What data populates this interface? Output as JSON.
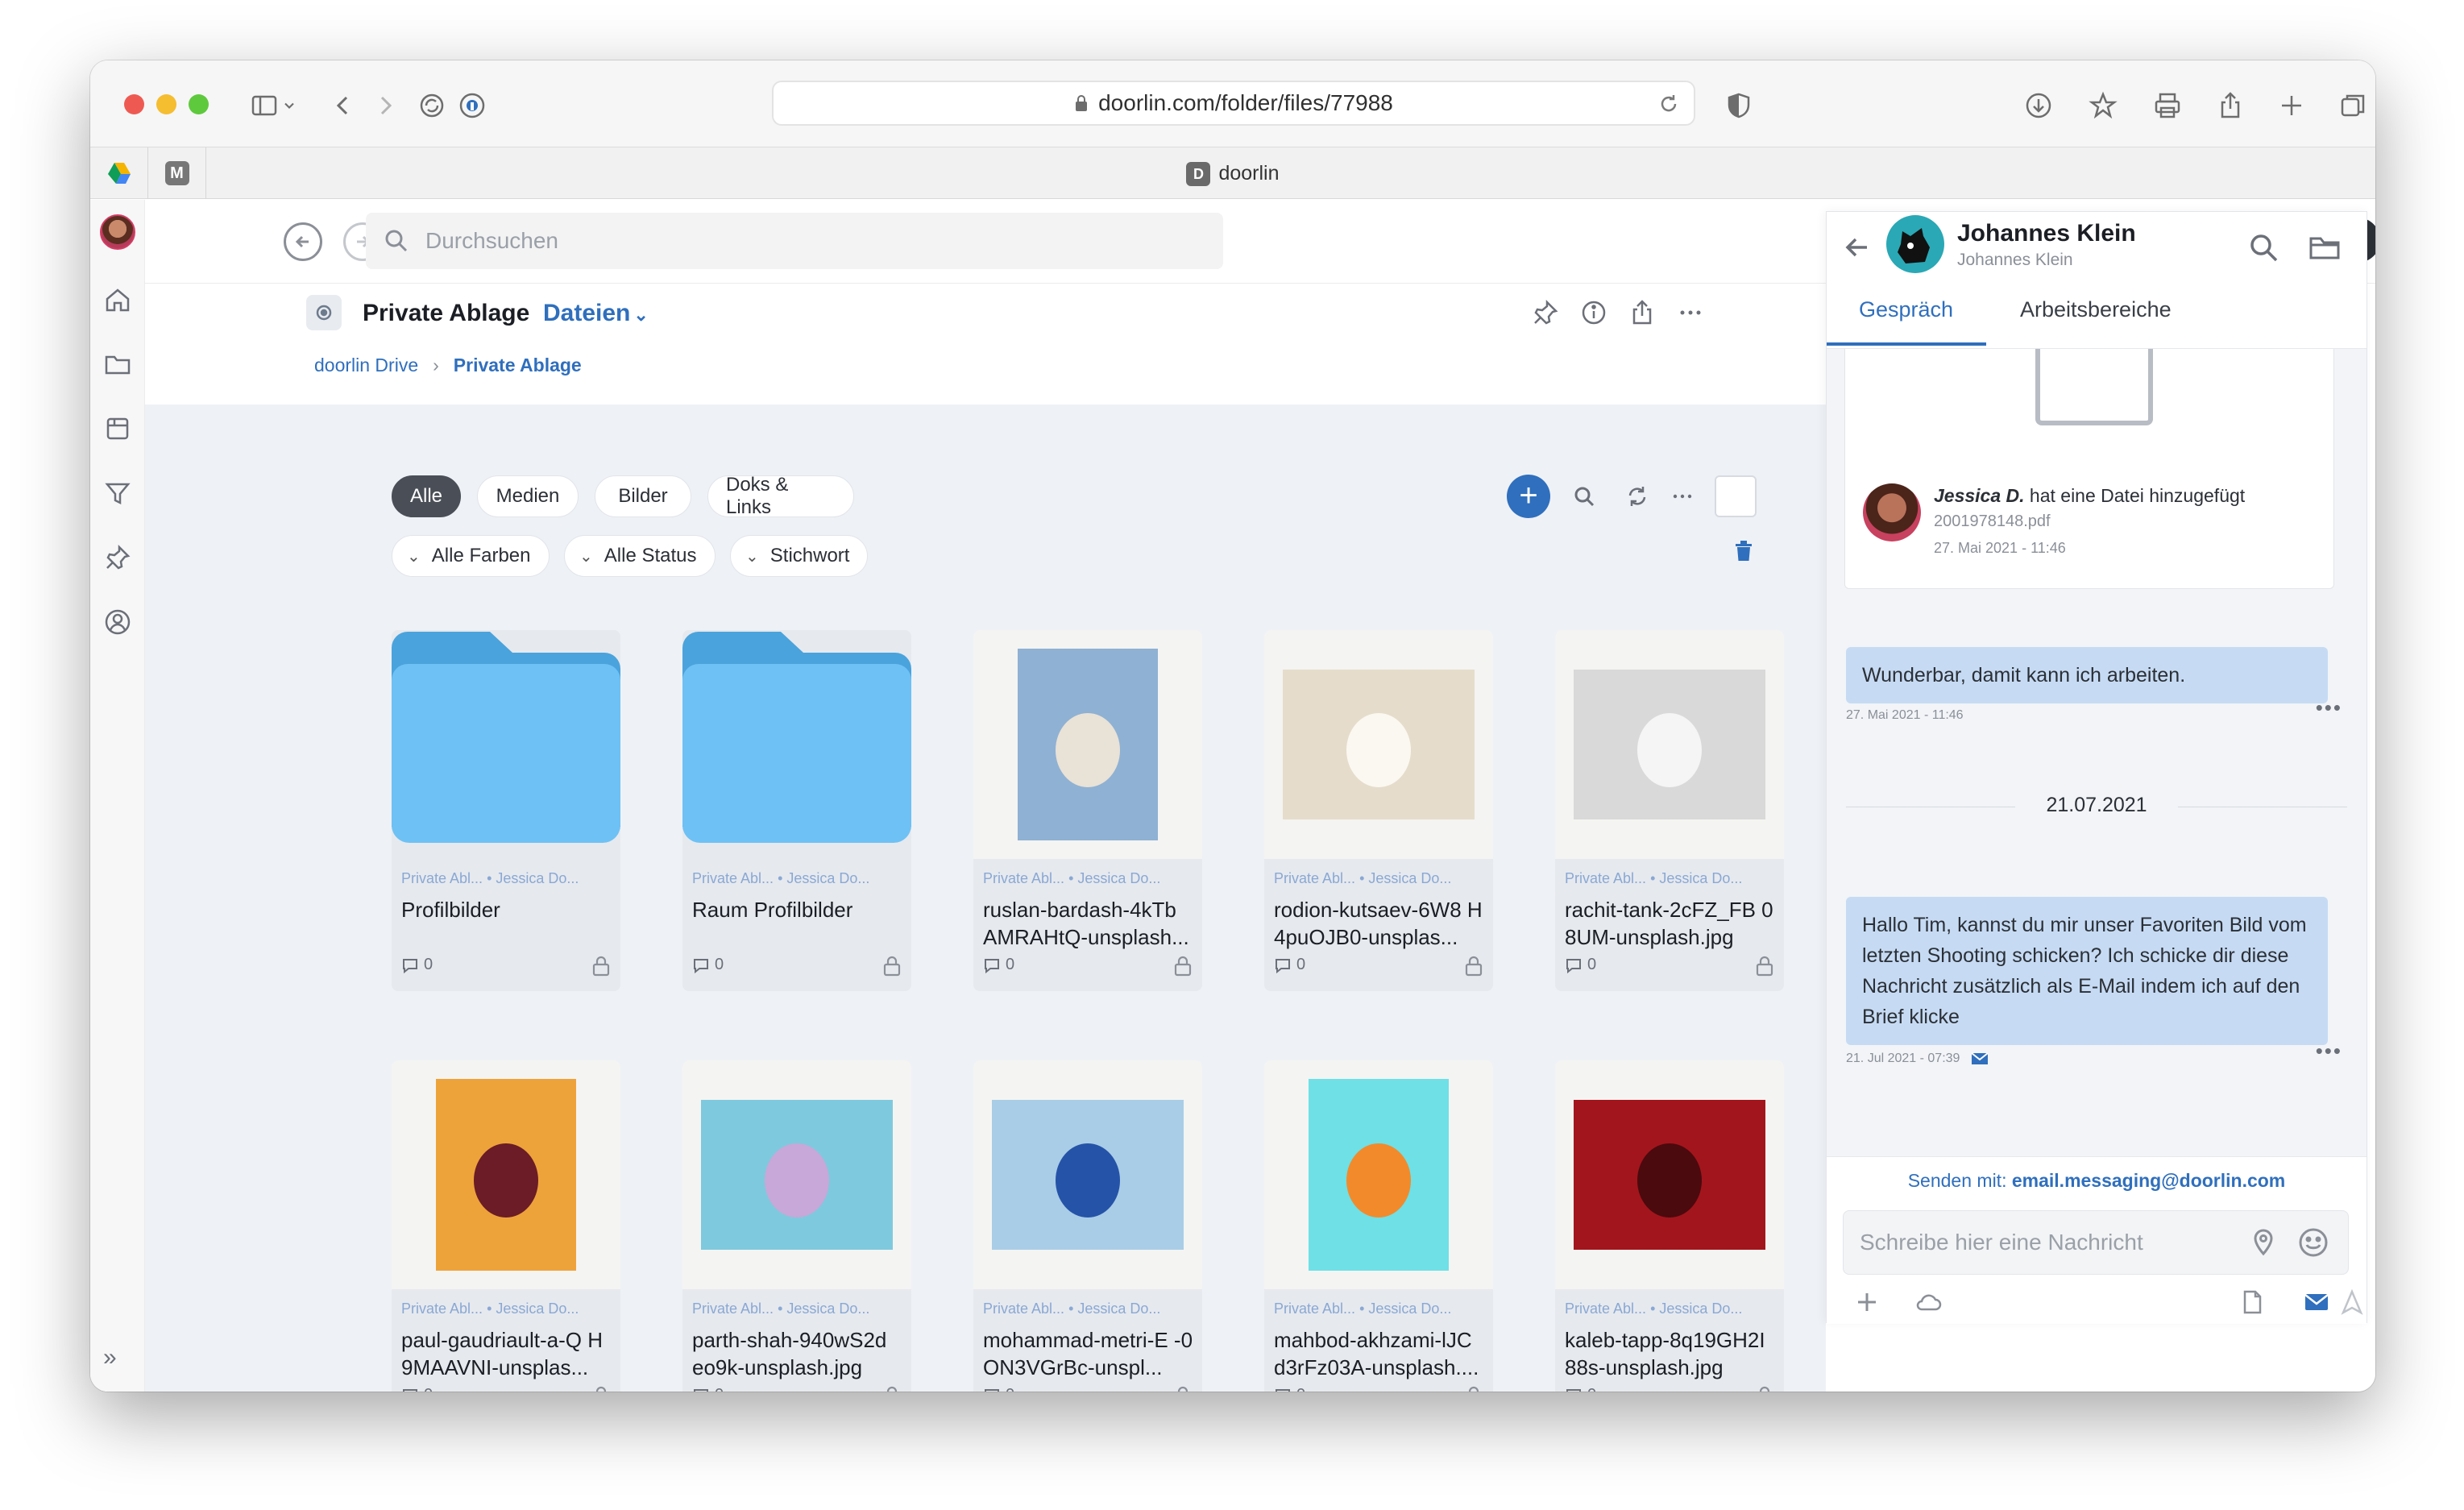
{
  "browser": {
    "url": "doorlin.com/folder/files/77988",
    "tab_title": "doorlin",
    "tab_favicon_letter": "D",
    "pinned_tab_2_letter": "M"
  },
  "search": {
    "placeholder": "Durchsuchen"
  },
  "header": {
    "title": "Private Ablage",
    "view_label": "Dateien",
    "breadcrumb": [
      "doorlin Drive",
      "Private Ablage"
    ]
  },
  "filters": {
    "chips": [
      "Alle",
      "Medien",
      "Bilder",
      "Doks & Links"
    ],
    "active_chip": "Alle",
    "dropdowns": [
      "Alle Farben",
      "Alle Status",
      "Stichwort"
    ]
  },
  "files": [
    {
      "kind": "folder",
      "meta_location": "Private Abl...",
      "meta_owner": "Jessica Do...",
      "name": "Profilbilder",
      "comments": "0"
    },
    {
      "kind": "folder",
      "meta_location": "Private Abl...",
      "meta_owner": "Jessica Do...",
      "name": "Raum Profilbilder",
      "comments": "0"
    },
    {
      "kind": "image",
      "meta_location": "Private Abl...",
      "meta_owner": "Jessica Do...",
      "name": "ruslan-bardash-4kTb AMRAHtQ-unsplash...",
      "comments": "0",
      "thumb_bg": "#8fb1d3",
      "thumb_fg": "#e9e2d6",
      "thumb_ground": "#f4f4f2"
    },
    {
      "kind": "image",
      "meta_location": "Private Abl...",
      "meta_owner": "Jessica Do...",
      "name": "rodion-kutsaev-6W8 H4puOJB0-unsplas...",
      "comments": "0",
      "thumb_bg": "#e5dccb",
      "thumb_fg": "#fbf8f1",
      "thumb_ground": "#f4f4f2"
    },
    {
      "kind": "image",
      "meta_location": "Private Abl...",
      "meta_owner": "Jessica Do...",
      "name": "rachit-tank-2cFZ_FB 08UM-unsplash.jpg",
      "comments": "0",
      "thumb_bg": "#d9d9d9",
      "thumb_fg": "#f5f5f5",
      "thumb_ground": "#f4f4f2"
    },
    {
      "kind": "image",
      "meta_location": "Private Abl...",
      "meta_owner": "Jessica Do...",
      "name": "paul-gaudriault-a-Q H9MAAVNI-unsplas...",
      "comments": "0",
      "thumb_bg": "#eea33a",
      "thumb_fg": "#6b1c26",
      "thumb_ground": "#f4f4f2"
    },
    {
      "kind": "image",
      "meta_location": "Private Abl...",
      "meta_owner": "Jessica Do...",
      "name": "parth-shah-940wS2d eo9k-unsplash.jpg",
      "comments": "0",
      "thumb_bg": "#7fc9de",
      "thumb_fg": "#c7a8d8",
      "thumb_ground": "#f4f4f2"
    },
    {
      "kind": "image",
      "meta_location": "Private Abl...",
      "meta_owner": "Jessica Do...",
      "name": "mohammad-metri-E -0ON3VGrBc-unspl...",
      "comments": "0",
      "thumb_bg": "#a9cde6",
      "thumb_fg": "#2553a8",
      "thumb_ground": "#f4f4f2"
    },
    {
      "kind": "image",
      "meta_location": "Private Abl...",
      "meta_owner": "Jessica Do...",
      "name": "mahbod-akhzami-lJC d3rFz03A-unsplash....",
      "comments": "0",
      "thumb_bg": "#6ee0e6",
      "thumb_fg": "#f28a2c",
      "thumb_ground": "#f4f4f2"
    },
    {
      "kind": "image",
      "meta_location": "Private Abl...",
      "meta_owner": "Jessica Do...",
      "name": "kaleb-tapp-8q19GH2I 88s-unsplash.jpg",
      "comments": "0",
      "thumb_bg": "#a3151c",
      "thumb_fg": "#4a0a0e",
      "thumb_ground": "#f4f4f2"
    }
  ],
  "chat": {
    "name": "Johannes Klein",
    "subtitle": "Johannes Klein",
    "tabs": [
      "Gespräch",
      "Arbeitsbereiche"
    ],
    "active_tab": "Gespräch",
    "file_event": {
      "author": "Jessica D.",
      "action": " hat eine Datei hinzugefügt",
      "filename": "2001978148.pdf",
      "time": "27. Mai 2021 - 11:46"
    },
    "messages": [
      {
        "text": "Wunderbar, damit kann ich arbeiten.",
        "time": "27. Mai 2021 - 11:46"
      },
      {
        "text": "Hallo Tim, kannst du mir unser Favoriten Bild vom letzten Shooting schicken? Ich schicke dir diese Nachricht zusätzlich als E-Mail indem ich auf den Brief klicke",
        "time": "21. Jul 2021 - 07:39"
      }
    ],
    "date_separator": "21.07.2021",
    "send_with_label": "Senden mit:",
    "send_with_address": "email.messaging@doorlin.com",
    "input_placeholder": "Schreibe hier eine Nachricht"
  },
  "colors": {
    "accent": "#2f6fbd",
    "bubble": "#c6dbf3",
    "content_bg": "#eef1f6",
    "folder_front": "#6ec1f4",
    "folder_back": "#4aa3dc",
    "traffic_red": "#ee5a52",
    "traffic_yellow": "#f5bd30",
    "traffic_green": "#5fc93d"
  }
}
